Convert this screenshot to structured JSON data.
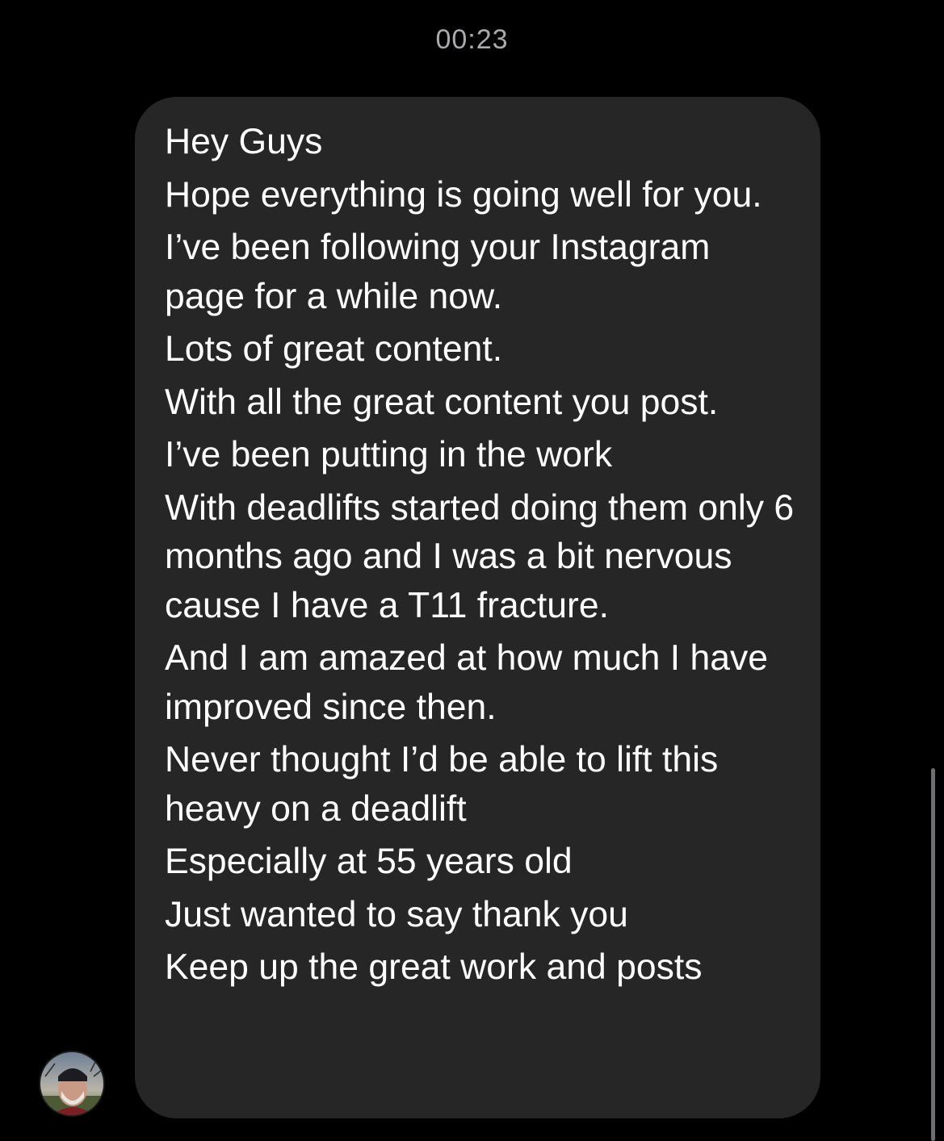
{
  "thread": {
    "timestamp": "00:23"
  },
  "message": {
    "lines": [
      "Hey Guys",
      "Hope everything is going well for you.",
      "I’ve been following your Instagram page for a while now.",
      "Lots of great content.",
      "With all the great content you post.",
      "I’ve been putting in the work",
      "With deadlifts started doing them only 6 months ago and I was a bit nervous cause I have a  T11 fracture.",
      "And I am amazed at how much I have improved since then.",
      "Never thought I’d be able to lift this heavy on a deadlift",
      "Especially at 55 years old",
      "Just wanted to say thank you",
      "Keep up the great work and posts"
    ]
  },
  "colors": {
    "background": "#000000",
    "bubble": "#262626",
    "text": "#ffffff",
    "timestamp": "#a9a9ae"
  },
  "icons": {
    "avatar": "sender-avatar"
  }
}
